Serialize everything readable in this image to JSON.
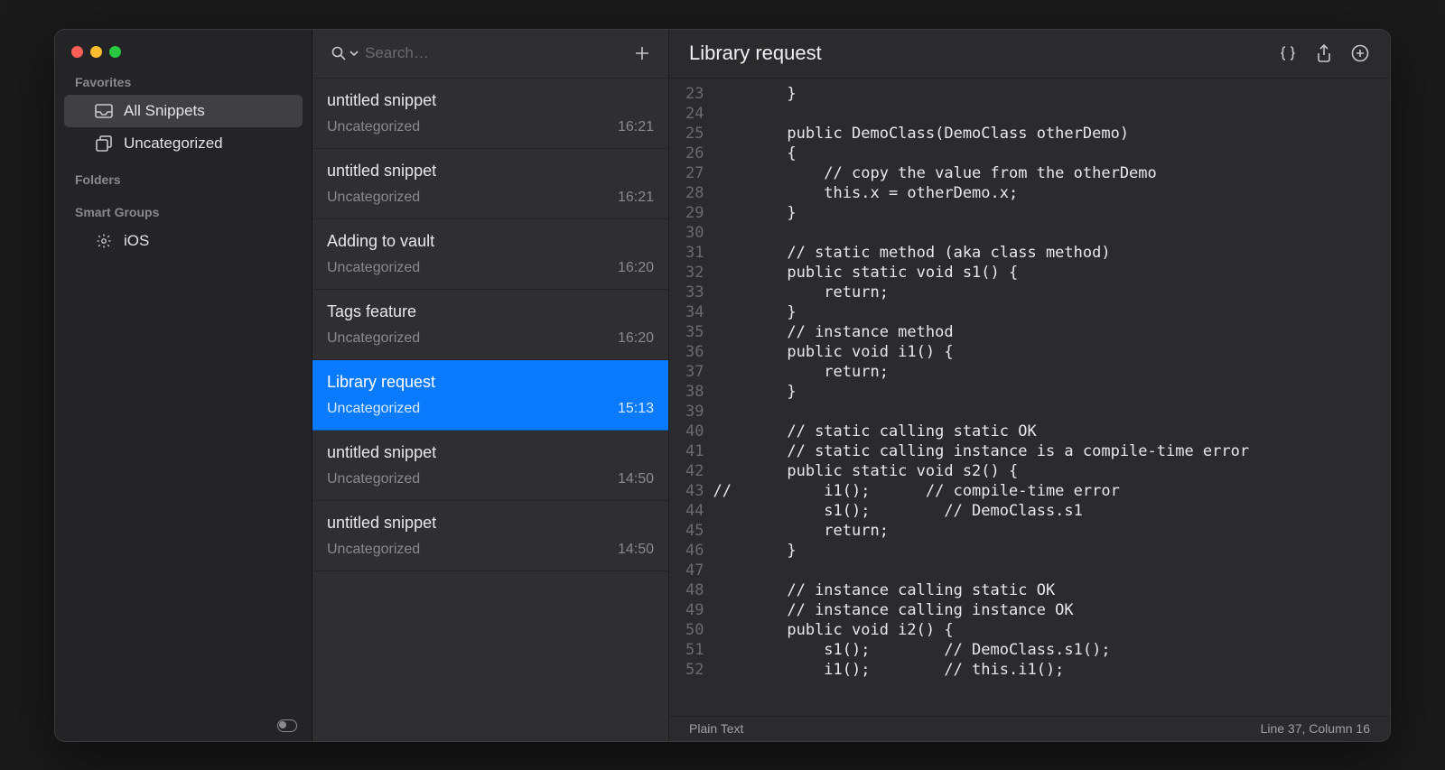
{
  "sidebar": {
    "sections": {
      "favorites": {
        "label": "Favorites",
        "items": [
          {
            "id": "all-snippets",
            "label": "All Snippets",
            "icon": "tray",
            "selected": true
          },
          {
            "id": "uncategorized",
            "label": "Uncategorized",
            "icon": "square-stack",
            "selected": false
          }
        ]
      },
      "folders": {
        "label": "Folders",
        "items": []
      },
      "smart_groups": {
        "label": "Smart Groups",
        "items": [
          {
            "id": "ios",
            "label": "iOS",
            "icon": "gear",
            "selected": false
          }
        ]
      }
    }
  },
  "search": {
    "placeholder": "Search…",
    "value": ""
  },
  "snippet_list": [
    {
      "title": "untitled snippet",
      "category": "Uncategorized",
      "time": "16:21",
      "selected": false
    },
    {
      "title": "untitled snippet",
      "category": "Uncategorized",
      "time": "16:21",
      "selected": false
    },
    {
      "title": "Adding to vault",
      "category": "Uncategorized",
      "time": "16:20",
      "selected": false
    },
    {
      "title": "Tags feature",
      "category": "Uncategorized",
      "time": "16:20",
      "selected": false
    },
    {
      "title": "Library request",
      "category": "Uncategorized",
      "time": "15:13",
      "selected": true
    },
    {
      "title": "untitled snippet",
      "category": "Uncategorized",
      "time": "14:50",
      "selected": false
    },
    {
      "title": "untitled snippet",
      "category": "Uncategorized",
      "time": "14:50",
      "selected": false
    }
  ],
  "editor": {
    "title": "Library request",
    "first_line_number": 23,
    "lines": [
      "        }",
      "",
      "        public DemoClass(DemoClass otherDemo)",
      "        {",
      "            // copy the value from the otherDemo",
      "            this.x = otherDemo.x;",
      "        }",
      "",
      "        // static method (aka class method)",
      "        public static void s1() {",
      "            return;",
      "        }",
      "        // instance method",
      "        public void i1() {",
      "            return;",
      "        }",
      "",
      "        // static calling static OK",
      "        // static calling instance is a compile-time error",
      "        public static void s2() {",
      "//          i1();      // compile-time error",
      "            s1();        // DemoClass.s1",
      "            return;",
      "        }",
      "",
      "        // instance calling static OK",
      "        // instance calling instance OK",
      "        public void i2() {",
      "            s1();        // DemoClass.s1();",
      "            i1();        // this.i1();"
    ]
  },
  "status": {
    "language": "Plain Text",
    "position": "Line 37, Column 16"
  }
}
